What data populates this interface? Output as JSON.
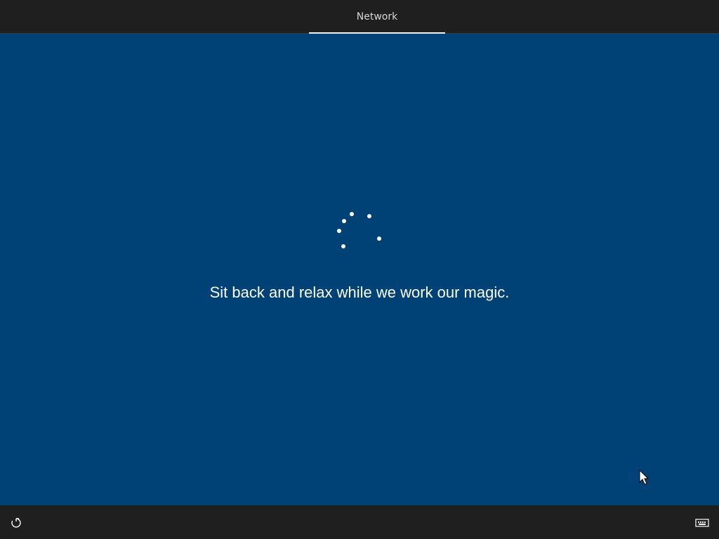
{
  "header": {
    "active_tab_label": "Network"
  },
  "main": {
    "message": "Sit back and relax while we work our magic."
  },
  "footer": {
    "left_icon": "ease-of-access-icon",
    "right_icon": "keyboard-icon"
  },
  "colors": {
    "background": "#004275",
    "bar": "#1f1f1f",
    "text": "#ffffff"
  }
}
